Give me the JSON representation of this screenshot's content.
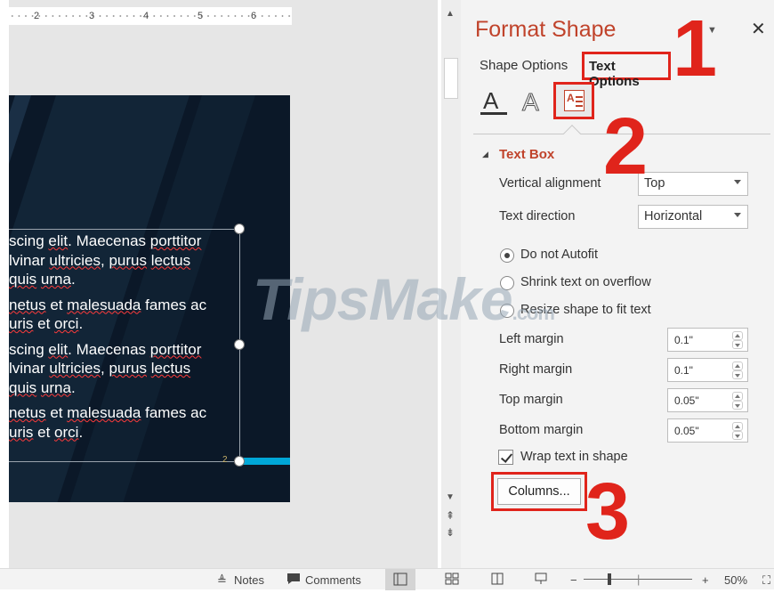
{
  "ruler": {
    "numbers": [
      "2",
      "3",
      "4",
      "5",
      "6"
    ]
  },
  "slide": {
    "paragraphs": [
      {
        "lines": [
          [
            {
              "t": "scing "
            },
            {
              "t": "elit",
              "sq": true
            },
            {
              "t": ". Maecenas "
            },
            {
              "t": "porttitor",
              "sq": true
            }
          ],
          [
            {
              "t": "lvinar "
            },
            {
              "t": "ultricies",
              "sq": true
            },
            {
              "t": ", "
            },
            {
              "t": "purus",
              "sq": true
            },
            {
              "t": " "
            },
            {
              "t": "lectus",
              "sq": true
            }
          ],
          [
            {
              "t": "quis",
              "sq": true
            },
            {
              "t": " "
            },
            {
              "t": "urna",
              "sq": true
            },
            {
              "t": "."
            }
          ]
        ]
      },
      {
        "lines": [
          [
            {
              "t": "netus",
              "sq": true
            },
            {
              "t": " et "
            },
            {
              "t": "malesuada",
              "sq": true
            },
            {
              "t": " fames ac"
            }
          ],
          [
            {
              "t": "uris",
              "sq": true
            },
            {
              "t": " et "
            },
            {
              "t": "orci",
              "sq": true
            },
            {
              "t": "."
            }
          ]
        ]
      },
      {
        "lines": [
          [
            {
              "t": "scing "
            },
            {
              "t": "elit",
              "sq": true
            },
            {
              "t": ". Maecenas "
            },
            {
              "t": "porttitor",
              "sq": true
            }
          ],
          [
            {
              "t": "lvinar "
            },
            {
              "t": "ultricies",
              "sq": true
            },
            {
              "t": ", "
            },
            {
              "t": "purus",
              "sq": true
            },
            {
              "t": " "
            },
            {
              "t": "lectus",
              "sq": true
            }
          ],
          [
            {
              "t": "quis",
              "sq": true
            },
            {
              "t": " "
            },
            {
              "t": "urna",
              "sq": true
            },
            {
              "t": "."
            }
          ]
        ]
      },
      {
        "lines": [
          [
            {
              "t": "netus",
              "sq": true
            },
            {
              "t": " et "
            },
            {
              "t": "malesuada",
              "sq": true
            },
            {
              "t": " fames ac"
            }
          ],
          [
            {
              "t": "uris",
              "sq": true
            },
            {
              "t": " et "
            },
            {
              "t": "orci",
              "sq": true
            },
            {
              "t": "."
            }
          ]
        ]
      }
    ],
    "handle_number": "2"
  },
  "watermark": {
    "text": "TipsMake",
    "suffix": ".com"
  },
  "pane": {
    "title": "Format Shape",
    "tabs": {
      "shape": "Shape Options",
      "text": "Text Options"
    },
    "section": "Text Box",
    "vertical_alignment": {
      "label": "Vertical alignment",
      "value": "Top"
    },
    "text_direction": {
      "label": "Text direction",
      "value": "Horizontal"
    },
    "autofit": {
      "do_not": "Do not Autofit",
      "shrink": "Shrink text on overflow",
      "resize": "Resize shape to fit text",
      "selected": "do_not"
    },
    "margins": {
      "left": {
        "label": "Left margin",
        "value": "0.1\""
      },
      "right": {
        "label": "Right margin",
        "value": "0.1\""
      },
      "top": {
        "label": "Top margin",
        "value": "0.05\""
      },
      "bottom": {
        "label": "Bottom margin",
        "value": "0.05\""
      }
    },
    "wrap": {
      "label": "Wrap text in shape",
      "checked": true
    },
    "columns_label": "Columns...",
    "callouts": [
      "1",
      "2",
      "3"
    ]
  },
  "statusbar": {
    "notes": "Notes",
    "comments": "Comments",
    "zoom": "50%"
  },
  "colors": {
    "accent": "#c0432b",
    "callout": "#e0241b",
    "slide_bg": "#0b1828",
    "slide_accent": "#00a7d8"
  },
  "icons": [
    "text-fill-icon",
    "text-outline-icon",
    "textbox-icon",
    "close-icon",
    "notes-icon",
    "comments-icon",
    "normal-view-icon",
    "slide-sorter-icon",
    "reading-view-icon",
    "slideshow-icon"
  ]
}
